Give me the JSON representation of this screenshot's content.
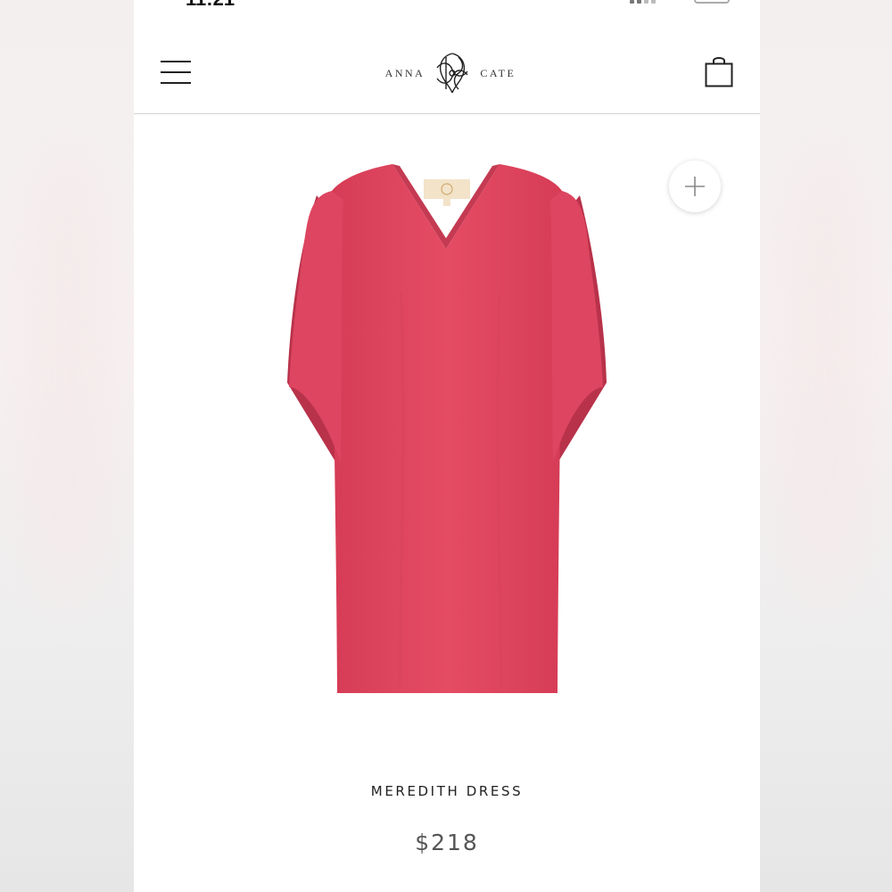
{
  "status_bar": {
    "time": "11:21"
  },
  "header": {
    "brand_left": "ANNA",
    "brand_right": "CATE",
    "menu_icon": "hamburger-menu-icon",
    "cart_icon": "shopping-bag-icon"
  },
  "product": {
    "name": "MEREDITH DRESS",
    "price": "$218",
    "color": "#e0465f",
    "quick_add_icon": "plus-icon"
  }
}
